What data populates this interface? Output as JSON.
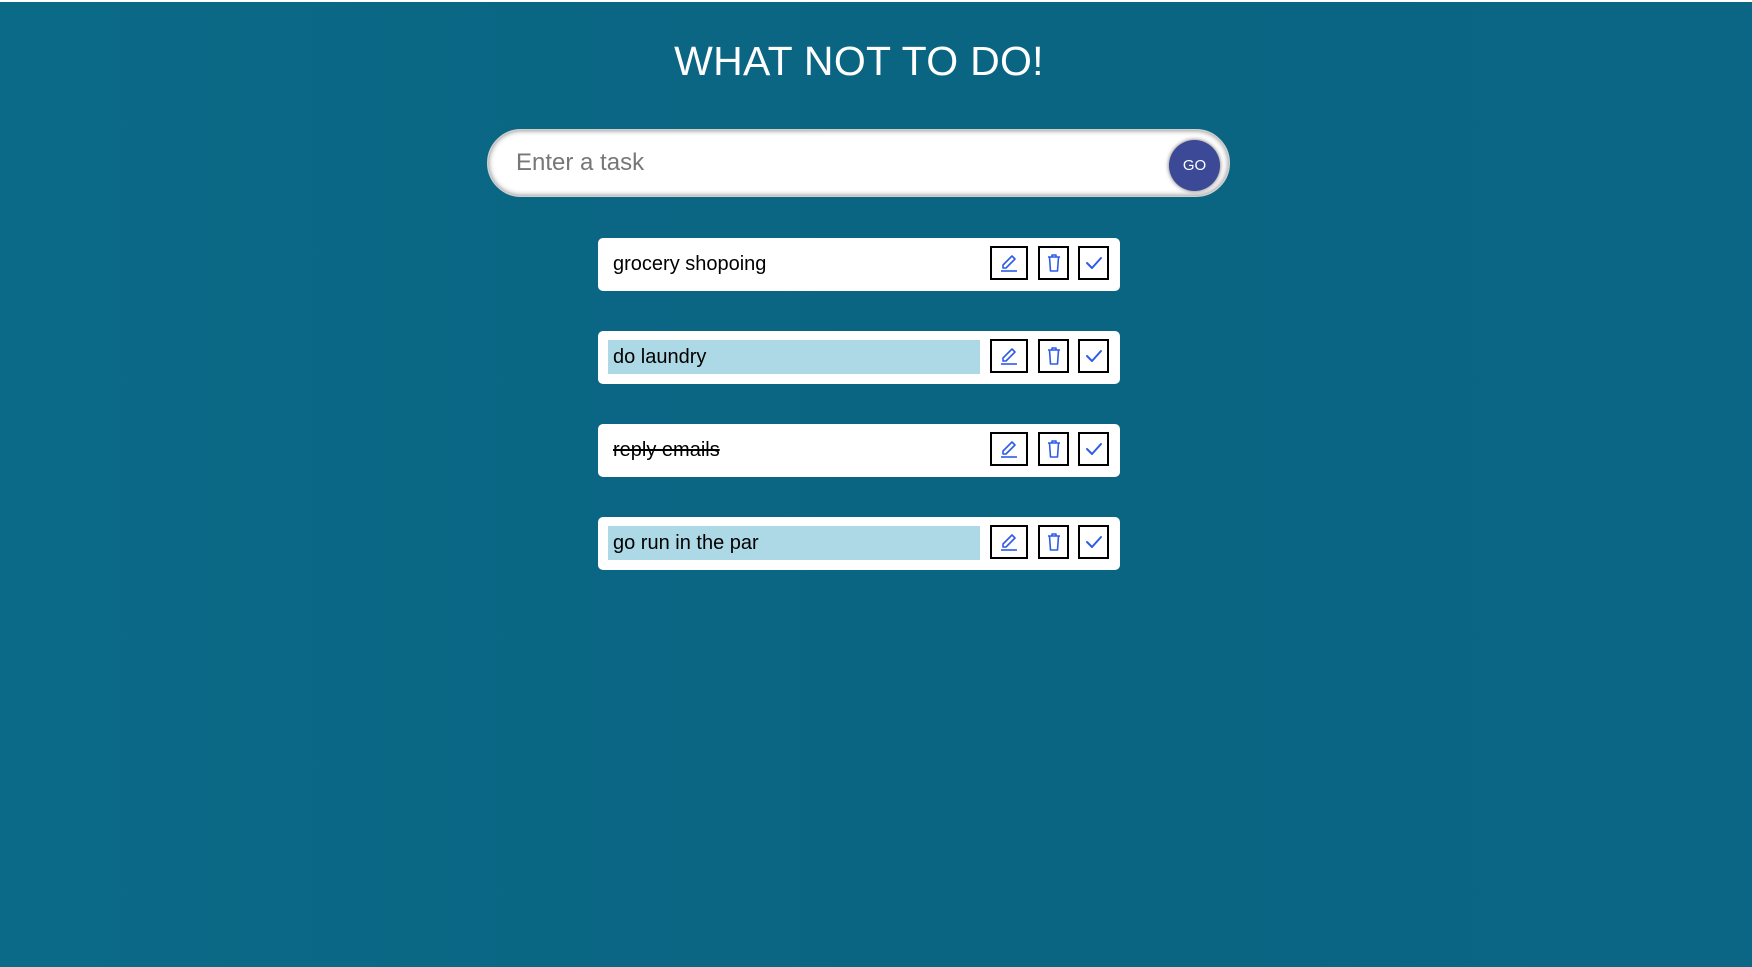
{
  "header": {
    "title": "WHAT NOT TO DO!"
  },
  "task_form": {
    "placeholder": "Enter a task",
    "value": "",
    "submit_label": "GO"
  },
  "todos": [
    {
      "text": "grocery shopoing",
      "highlighted": false,
      "completed": false
    },
    {
      "text": "do laundry",
      "highlighted": true,
      "completed": false
    },
    {
      "text": "reply emails",
      "highlighted": false,
      "completed": true
    },
    {
      "text": "go run in the par",
      "highlighted": true,
      "completed": false
    }
  ],
  "icons": {
    "edit": "pencil-icon",
    "delete": "trash-icon",
    "done": "check-icon"
  },
  "colors": {
    "background": "#0a6582",
    "go_button": "#3b4996",
    "highlight": "#add8e6",
    "icon_stroke": "#2f5be8"
  }
}
